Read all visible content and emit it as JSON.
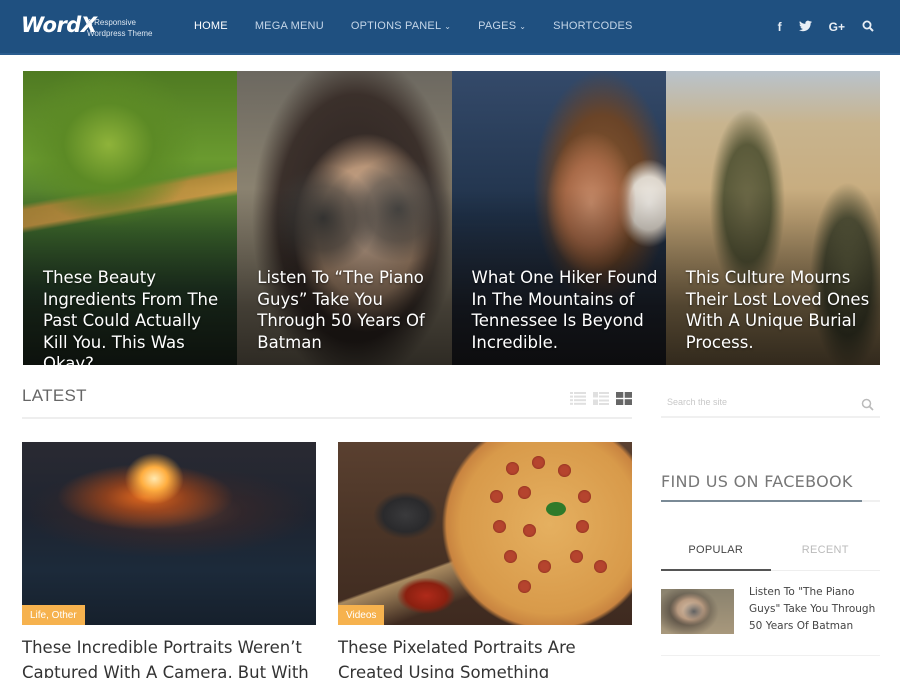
{
  "header": {
    "logo": "WordX",
    "tagline_line1": "A Responsive",
    "tagline_line2": "Wordpress Theme",
    "nav": [
      {
        "label": "HOME",
        "active": true,
        "dropdown": false
      },
      {
        "label": "MEGA MENU",
        "active": false,
        "dropdown": false
      },
      {
        "label": "OPTIONS PANEL",
        "active": false,
        "dropdown": true
      },
      {
        "label": "PAGES",
        "active": false,
        "dropdown": true
      },
      {
        "label": "SHORTCODES",
        "active": false,
        "dropdown": false
      }
    ],
    "social_icons": [
      "facebook-icon",
      "twitter-icon",
      "google-plus-icon",
      "search-icon"
    ],
    "google_plus_label": "G+",
    "facebook_label": "f",
    "colors": {
      "background": "#1f5080"
    }
  },
  "featured": [
    {
      "title": "These Beauty Ingredients From The Past Could Actually Kill You. This Was Okay?"
    },
    {
      "title": "Listen To “The Piano Guys” Take You Through 50 Years Of Batman"
    },
    {
      "title": "What One Hiker Found In The Mountains of Tennessee Is Beyond Incredible."
    },
    {
      "title": "This Culture Mourns Their Lost Loved Ones With A Unique Burial Process."
    }
  ],
  "latest": {
    "title": "LATEST",
    "view_modes": [
      "list-view-icon",
      "compact-list-view-icon",
      "grid-view-icon"
    ],
    "active_view": "grid",
    "posts": [
      {
        "category": "Life, Other",
        "title": "These Incredible Portraits Weren’t Captured With A Camera, But With"
      },
      {
        "category": "Videos",
        "title": "These Pixelated Portraits Are Created Using Something"
      }
    ],
    "colors": {
      "category_badge": "#f6b24e"
    }
  },
  "sidebar": {
    "search_placeholder": "Search the site",
    "facebook_title": "FIND US ON FACEBOOK",
    "tabs": [
      {
        "label": "POPULAR",
        "active": true
      },
      {
        "label": "RECENT",
        "active": false
      }
    ],
    "popular": [
      {
        "title": "Listen To \"The Piano Guys\" Take You Through 50 Years Of Batman"
      }
    ]
  }
}
